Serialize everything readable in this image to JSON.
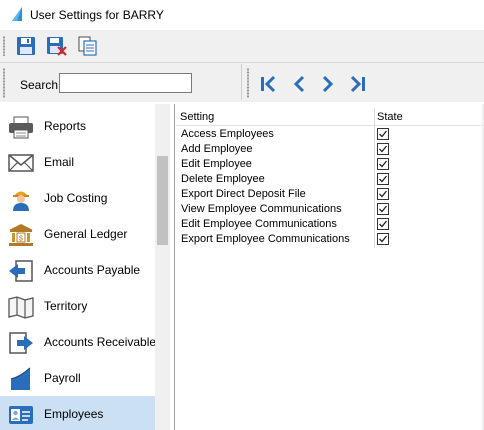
{
  "window": {
    "title": "User Settings for BARRY"
  },
  "toolbar": {
    "buttons": [
      "save-icon",
      "save-close-icon",
      "copy-icon"
    ]
  },
  "search": {
    "label": "Search",
    "value": "",
    "placeholder": ""
  },
  "navigation": {
    "buttons": [
      "first-record-icon",
      "previous-record-icon",
      "next-record-icon",
      "last-record-icon"
    ]
  },
  "sidebar": {
    "items": [
      {
        "label": "Reports",
        "icon": "printer-icon"
      },
      {
        "label": "Email",
        "icon": "envelope-icon"
      },
      {
        "label": "Job Costing",
        "icon": "worker-icon"
      },
      {
        "label": "General Ledger",
        "icon": "bank-icon"
      },
      {
        "label": "Accounts Payable",
        "icon": "payable-icon"
      },
      {
        "label": "Territory",
        "icon": "map-icon"
      },
      {
        "label": "Accounts Receivable",
        "icon": "receivable-icon"
      },
      {
        "label": "Payroll",
        "icon": "payroll-icon"
      },
      {
        "label": "Employees",
        "icon": "id-badge-icon",
        "selected": true
      }
    ]
  },
  "grid": {
    "columns": [
      "Setting",
      "State"
    ],
    "rows": [
      {
        "setting": "Access Employees",
        "state": true
      },
      {
        "setting": "Add Employee",
        "state": true
      },
      {
        "setting": "Edit Employee",
        "state": true
      },
      {
        "setting": "Delete Employee",
        "state": true
      },
      {
        "setting": "Export Direct Deposit File",
        "state": true
      },
      {
        "setting": "View Employee Communications",
        "state": true
      },
      {
        "setting": "Edit Employee Communications",
        "state": true
      },
      {
        "setting": "Export Employee Communications",
        "state": true
      }
    ]
  },
  "colors": {
    "icon_blue": "#2a6ebb",
    "selected_bg": "#cce0f4",
    "toolbar_bg": "#f0f0f0"
  }
}
